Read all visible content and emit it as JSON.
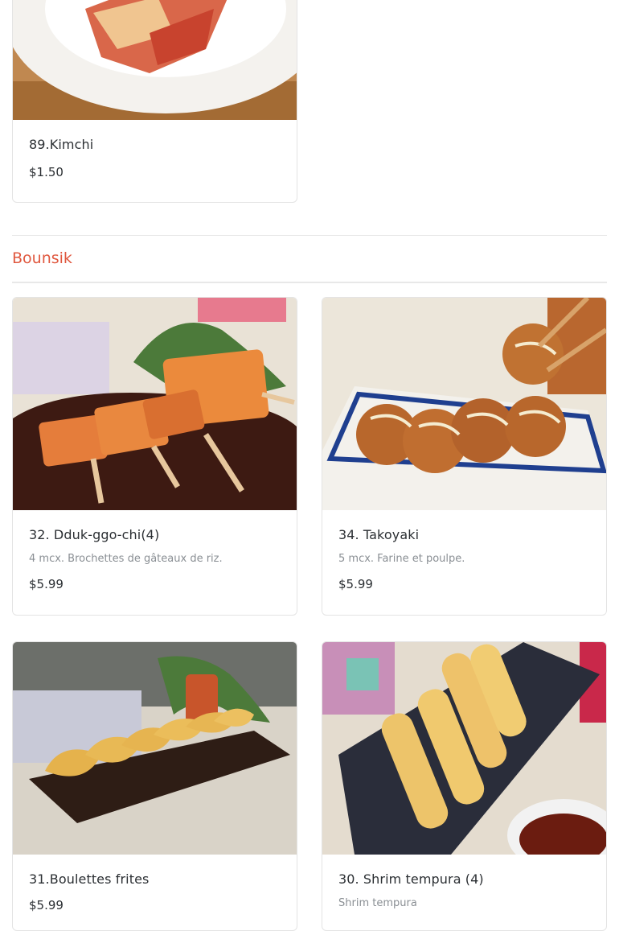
{
  "sections": [
    {
      "title": "",
      "items": [
        {
          "name": "89.Kimchi",
          "description": "",
          "price": "$1.50",
          "image_icon": "kimchi-dish-photo"
        }
      ]
    },
    {
      "title": "Bounsik",
      "items": [
        {
          "name": "32. Dduk-ggo-chi(4)",
          "description": "4 mcx. Brochettes de gâteaux de riz.",
          "price": "$5.99",
          "image_icon": "rice-cake-skewers-photo"
        },
        {
          "name": "34. Takoyaki",
          "description": "5 mcx. Farine et poulpe.",
          "price": "$5.99",
          "image_icon": "takoyaki-photo"
        },
        {
          "name": "31.Boulettes frites",
          "description": "",
          "price": "$5.99",
          "image_icon": "fried-dumplings-photo"
        },
        {
          "name": "30. Shrim tempura (4)",
          "description": "Shrim tempura",
          "price": "",
          "image_icon": "shrimp-tempura-photo"
        }
      ]
    }
  ],
  "colors": {
    "accent": "#e0583f",
    "text": "#2b2f33",
    "muted": "#8a8f94",
    "border": "#e4e4e4"
  }
}
